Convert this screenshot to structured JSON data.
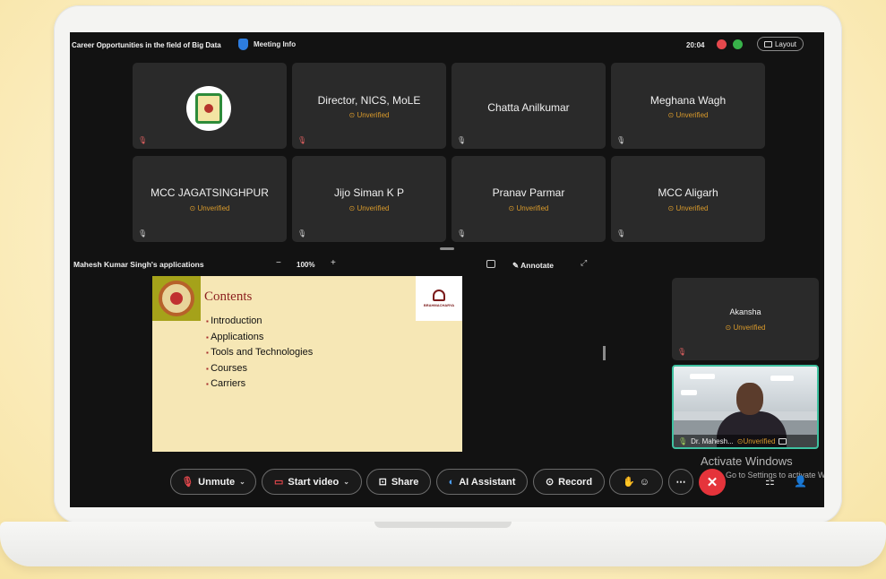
{
  "header": {
    "meeting_title": "Career Opportunities in the field of Big Data",
    "meeting_info_label": "Meeting Info",
    "clock": "20:04",
    "layout_label": "Layout"
  },
  "participants": [
    {
      "name": "",
      "status": ""
    },
    {
      "name": "Director, NICS, MoLE",
      "status": "Unverified"
    },
    {
      "name": "Chatta Anilkumar",
      "status": ""
    },
    {
      "name": "Meghana Wagh",
      "status": "Unverified"
    },
    {
      "name": "MCC JAGATSINGHPUR",
      "status": "Unverified"
    },
    {
      "name": "Jijo Siman K P",
      "status": "Unverified"
    },
    {
      "name": "Pranav Parmar",
      "status": "Unverified"
    },
    {
      "name": "MCC Aligarh",
      "status": "Unverified"
    },
    {
      "name": "Akansha",
      "status": "Unverified"
    }
  ],
  "share": {
    "label": "Mahesh Kumar Singh's applications",
    "zoom_minus": "−",
    "zoom": "100%",
    "zoom_plus": "+",
    "annotate_label": "Annotate"
  },
  "slide": {
    "title": "Contents",
    "right_logo_text": "BRAHMACHARYA",
    "items": [
      "Introduction",
      "Applications",
      "Tools and Technologies",
      "Courses",
      "Carriers"
    ]
  },
  "self_view": {
    "name": "Dr. Mahesh...",
    "status": "Unverified"
  },
  "watermark": {
    "title": "Activate Windows",
    "subtitle": "Go to Settings to activate Wi"
  },
  "controls": {
    "unmute": "Unmute",
    "start_video": "Start video",
    "share": "Share",
    "ai_assistant": "AI Assistant",
    "record": "Record"
  },
  "colors": {
    "unverified": "#d99a2b",
    "end_call": "#e5343b",
    "self_border": "#3ec1a0"
  }
}
